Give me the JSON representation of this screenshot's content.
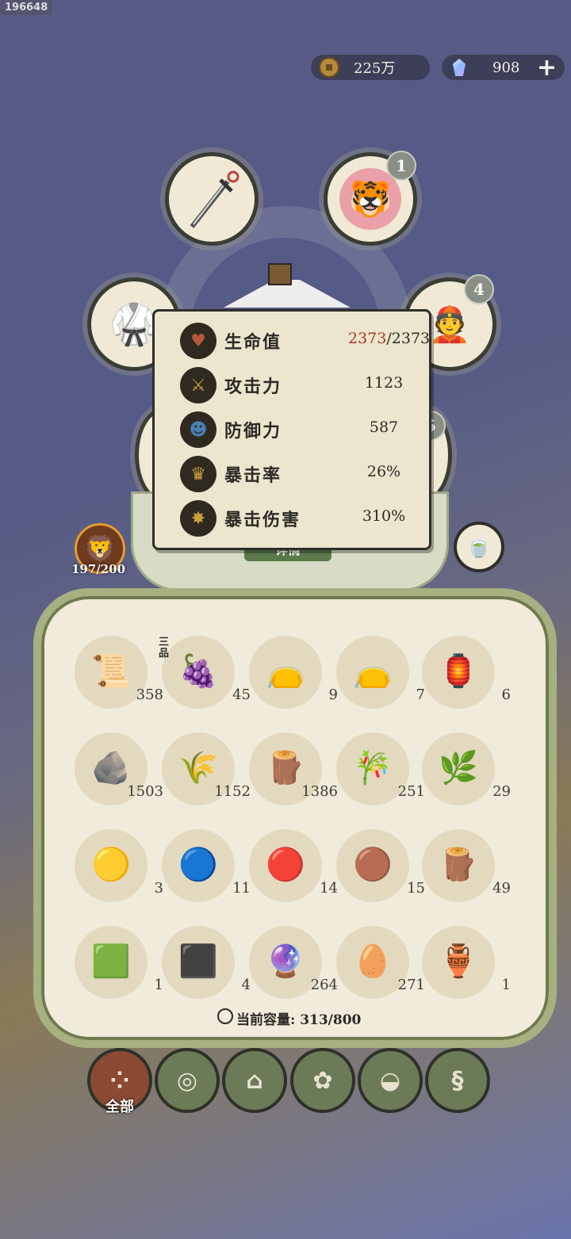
{
  "user_id": "196648",
  "currency": {
    "coins": "225万",
    "gems": "908"
  },
  "equipment": {
    "badge_top": "1",
    "badge_right": "4",
    "badge_mid": "5",
    "detail_label": "详情"
  },
  "player": {
    "level": "197/200"
  },
  "stats": [
    {
      "label": "生命值",
      "current": "2373",
      "max": "/2373",
      "icon": "heart-icon",
      "color": "#b7593e"
    },
    {
      "label": "攻击力",
      "value": "1123",
      "icon": "sword-icon",
      "color": "#c9a03c"
    },
    {
      "label": "防御力",
      "value": "587",
      "icon": "person-icon",
      "color": "#4b7fb3"
    },
    {
      "label": "暴击率",
      "value": "26%",
      "icon": "crown-icon",
      "color": "#c9a03c"
    },
    {
      "label": "暴击伤害",
      "value": "310%",
      "icon": "burst-icon",
      "color": "#c9a03c"
    }
  ],
  "inventory": [
    {
      "icon": "scroll-icon",
      "count": "358",
      "glyph": "📜"
    },
    {
      "icon": "grape-icon",
      "count": "45",
      "glyph": "🍇",
      "tag": "三品"
    },
    {
      "icon": "green-pouch-icon",
      "count": "9",
      "glyph": "👝"
    },
    {
      "icon": "blue-pouch-icon",
      "count": "7",
      "glyph": "👝"
    },
    {
      "icon": "token-icon",
      "count": "6",
      "glyph": "🏮"
    },
    {
      "icon": "stone-icon",
      "count": "1503",
      "glyph": "🪨"
    },
    {
      "icon": "grass-icon",
      "count": "1152",
      "glyph": "🌾"
    },
    {
      "icon": "log-icon",
      "count": "1386",
      "glyph": "🪵"
    },
    {
      "icon": "bamboo-icon",
      "count": "251",
      "glyph": "🎋"
    },
    {
      "icon": "herb-icon",
      "count": "29",
      "glyph": "🌿"
    },
    {
      "icon": "yellow-orb-icon",
      "count": "3",
      "glyph": "🟡"
    },
    {
      "icon": "blue-orb-icon",
      "count": "11",
      "glyph": "🔵"
    },
    {
      "icon": "red-orb-icon",
      "count": "14",
      "glyph": "🔴"
    },
    {
      "icon": "brown-orb-icon",
      "count": "15",
      "glyph": "🟤"
    },
    {
      "icon": "plank-icon",
      "count": "49",
      "glyph": "🪵"
    },
    {
      "icon": "jade-ingot-icon",
      "count": "1",
      "glyph": "🟩"
    },
    {
      "icon": "iron-ingot-icon",
      "count": "4",
      "glyph": "⬛"
    },
    {
      "icon": "spirit-orb-icon",
      "count": "264",
      "glyph": "🔮"
    },
    {
      "icon": "rice-icon",
      "count": "271",
      "glyph": "🥚"
    },
    {
      "icon": "gourd-icon",
      "count": "1",
      "glyph": "🏺"
    }
  ],
  "capacity": {
    "label": "当前容量: 313/800"
  },
  "tabs": [
    {
      "icon": "grid-icon",
      "label": "全部",
      "glyph": "⁘"
    },
    {
      "icon": "wood-icon",
      "glyph": "◎"
    },
    {
      "icon": "house-icon",
      "glyph": "⌂"
    },
    {
      "icon": "leaf-icon",
      "glyph": "✿"
    },
    {
      "icon": "bowl-icon",
      "glyph": "◒"
    },
    {
      "icon": "scroll-tab-icon",
      "glyph": "§"
    }
  ]
}
